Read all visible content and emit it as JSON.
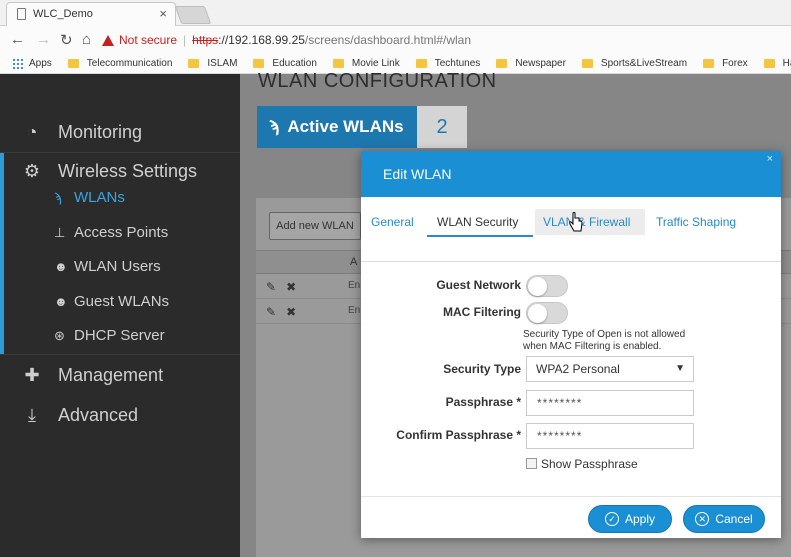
{
  "browser": {
    "tab_title": "WLC_Demo",
    "tab_close": "×",
    "not_secure": "Not secure",
    "url_scheme": "https",
    "url_host": "://192.168.99.25",
    "url_path": "/screens/dashboard.html#/wlan",
    "bookmarks": [
      "Apps",
      "Telecommunication",
      "ISLAM",
      "Education",
      "Movie Link",
      "Techtunes",
      "Newspaper",
      "Sports&LiveStream",
      "Forex",
      "Hacking"
    ]
  },
  "sidebar": {
    "monitoring": "Monitoring",
    "wireless_settings": "Wireless Settings",
    "sub_items": {
      "wlans": "WLANs",
      "access_points": "Access Points",
      "wlan_users": "WLAN Users",
      "guest_wlans": "Guest WLANs",
      "dhcp_server": "DHCP Server"
    },
    "management": "Management",
    "advanced": "Advanced"
  },
  "main": {
    "page_title": "WLAN CONFIGURATION",
    "active_wlans_label": "Active WLANs",
    "active_wlans_count": "2",
    "add_wlan_button": "Add new WLAN",
    "col_header_partial": "A",
    "rows": [
      {
        "cell": "En"
      },
      {
        "cell": "En"
      }
    ]
  },
  "modal": {
    "title": "Edit WLAN",
    "close": "×",
    "tabs": {
      "general": "General",
      "wlan_security": "WLAN Security",
      "vlan_firewall": "VLAN & Firewall",
      "traffic_shaping": "Traffic Shaping"
    },
    "selected_tab": "WLAN Security",
    "guest_network_label": "Guest Network",
    "guest_network_on": false,
    "mac_filtering_label": "MAC Filtering",
    "mac_filtering_on": false,
    "note_line1": "Security Type of Open is not allowed",
    "note_line2": "when MAC Filtering is enabled.",
    "security_type_label": "Security Type",
    "security_type_value": "WPA2 Personal",
    "passphrase_label": "Passphrase *",
    "passphrase_value": "********",
    "confirm_passphrase_label": "Confirm Passphrase *",
    "confirm_passphrase_value": "********",
    "show_passphrase_label": "Show Passphrase",
    "apply_button": "Apply",
    "cancel_button": "Cancel"
  },
  "colors": {
    "accent": "#1a8fd4",
    "sidebar_bg": "#2b2b2b",
    "sidebar_active": "#3aa3e0"
  }
}
